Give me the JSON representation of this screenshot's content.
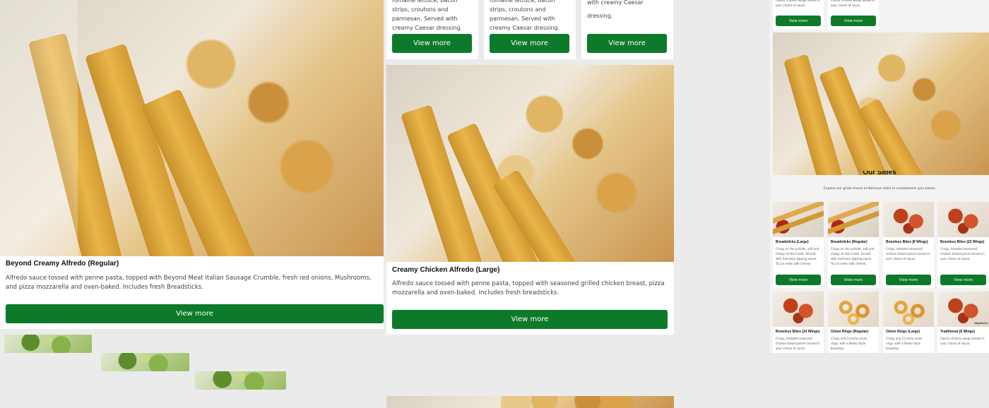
{
  "left_card": {
    "title": "Beyond Creamy Alfredo (Regular)",
    "description": "Alfredo sauce tossed with penne pasta, topped with Beyond Meat Italian Sausage Crumble, fresh red onions, Mushrooms, and pizza mozzarella and oven-baked. Includes fresh Breadsticks.",
    "button": "View more"
  },
  "middle_top_cards": [
    {
      "desc_fragment": "romaine lettuce, bacon strips, croutons and parmesan. Served with creamy Caesar dressing.",
      "button": "View more"
    },
    {
      "desc_fragment": "romaine lettuce, bacon strips, croutons and parmesan. Served with creamy Caesar dressing.",
      "button": "View more"
    },
    {
      "desc_fragment": "with creamy Caesar dressing.",
      "button": "View more"
    }
  ],
  "middle_card": {
    "title": "Creamy Chicken Alfredo (Large)",
    "description": "Alfredo sauce tossed with penne pasta, topped with seasoned grilled chicken breast, pizza mozzarella and oven-baked. Includes fresh breadsticks.",
    "button": "View more"
  },
  "right_panel": {
    "top_cards": [
      {
        "desc": "Classic chicken wings tossed in your choice of sauce.",
        "button": "View more"
      },
      {
        "desc": "Classic chicken wings tossed in your choice of sauce.",
        "button": "View more"
      }
    ],
    "sides_heading": "Our Sides",
    "sides_subheading": "Explore our great choice of delicious sides to complement your pizzas",
    "row1": [
      {
        "title": "Breadsticks (Large)",
        "desc": "Crispy on the outside, soft and chewy on the inside. Served with marinara dipping sauce. Try an order with cheese.",
        "button": "View more"
      },
      {
        "title": "Breadsticks (Regular)",
        "desc": "Crispy on the outside, soft and chewy on the inside. Served with marinara dipping sauce. Try an order with cheese.",
        "button": "View more"
      },
      {
        "title": "Boneless Bites (8 Wings)",
        "desc": "Crispy, breaded seasoned chicken breast pieces tossed in your choice of sauce.",
        "button": "View more"
      },
      {
        "title": "Boneless Bites (22 Wings)",
        "desc": "Crispy, breaded seasoned chicken breast pieces tossed in your choice of sauce.",
        "button": "View more"
      }
    ],
    "row2": [
      {
        "title": "Boneless Bites (14 Wings)",
        "desc": "Crispy, breaded seasoned chicken breast pieces tossed in your choice of sauce."
      },
      {
        "title": "Onion Rings (Regular)",
        "desc": "Crispy and Crunchy onion rings, with a Panko Style breading"
      },
      {
        "title": "Onion Rings (Large)",
        "desc": "Crispy and Crunchy onion rings, with a Panko Style breading"
      },
      {
        "title": "Traditional (8 Wings)",
        "desc": "Classic chicken wings tossed in your choice of sauce.",
        "badge": "MaySheet"
      }
    ]
  }
}
